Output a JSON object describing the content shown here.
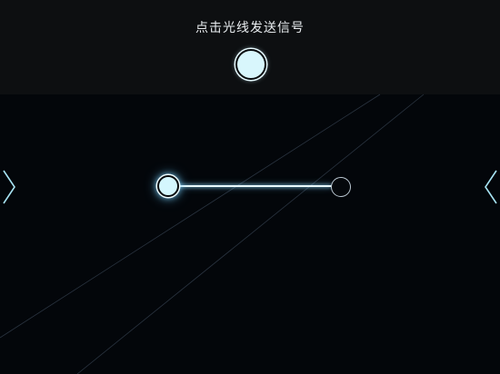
{
  "header": {
    "instruction": "点击光线发送信号"
  },
  "controls": {
    "send_signal_button": "send-signal",
    "prev_icon": "chevron-left-icon",
    "next_icon": "chevron-right-icon"
  },
  "colors": {
    "background": "#03060a",
    "panel": "#0d0f11",
    "glow": "#d4f6fd",
    "line": "#eaf9ff"
  }
}
